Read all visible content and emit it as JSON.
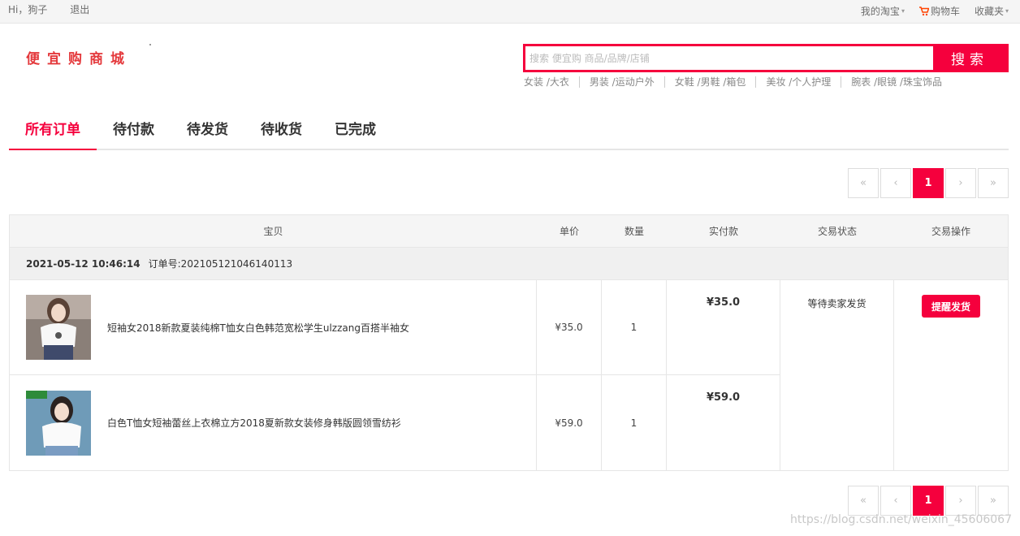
{
  "topbar": {
    "greeting": "Hi，狗子",
    "logout": "退出",
    "my_taobao": "我的淘宝",
    "cart": "购物车",
    "favorites": "收藏夹"
  },
  "header": {
    "logo": "便宜购商城",
    "search_placeholder": "搜索 便宜购 商品/品牌/店铺",
    "search_button": "搜索",
    "hot_links": [
      "女装 /大衣",
      "男装 /运动户外",
      "女鞋 /男鞋 /箱包",
      "美妆 /个人护理",
      "腕表 /眼镜 /珠宝饰品"
    ]
  },
  "tabs": [
    {
      "label": "所有订单",
      "active": true
    },
    {
      "label": "待付款",
      "active": false
    },
    {
      "label": "待发货",
      "active": false
    },
    {
      "label": "待收货",
      "active": false
    },
    {
      "label": "已完成",
      "active": false
    }
  ],
  "pagination": {
    "first": "«",
    "prev": "‹",
    "current": "1",
    "next": "›",
    "last": "»"
  },
  "table": {
    "headers": {
      "item": "宝贝",
      "price": "单价",
      "qty": "数量",
      "paid": "实付款",
      "status": "交易状态",
      "op": "交易操作"
    },
    "order": {
      "time": "2021-05-12 10:46:14",
      "order_no_label": "订单号:202105121046140113",
      "status": "等待卖家发货",
      "action": "提醒发货",
      "items": [
        {
          "title": "短袖女2018新款夏装纯棉T恤女白色韩范宽松学生ulzzang百搭半袖女",
          "price": "¥35.0",
          "qty": "1",
          "paid": "¥35.0"
        },
        {
          "title": "白色T恤女短袖蕾丝上衣棉立方2018夏新款女装修身韩版圆领雪纺衫",
          "price": "¥59.0",
          "qty": "1",
          "paid": "¥59.0"
        }
      ]
    }
  },
  "watermark": "https://blog.csdn.net/weixin_45606067",
  "colors": {
    "accent": "#f5003d",
    "logo": "#e4393c"
  }
}
